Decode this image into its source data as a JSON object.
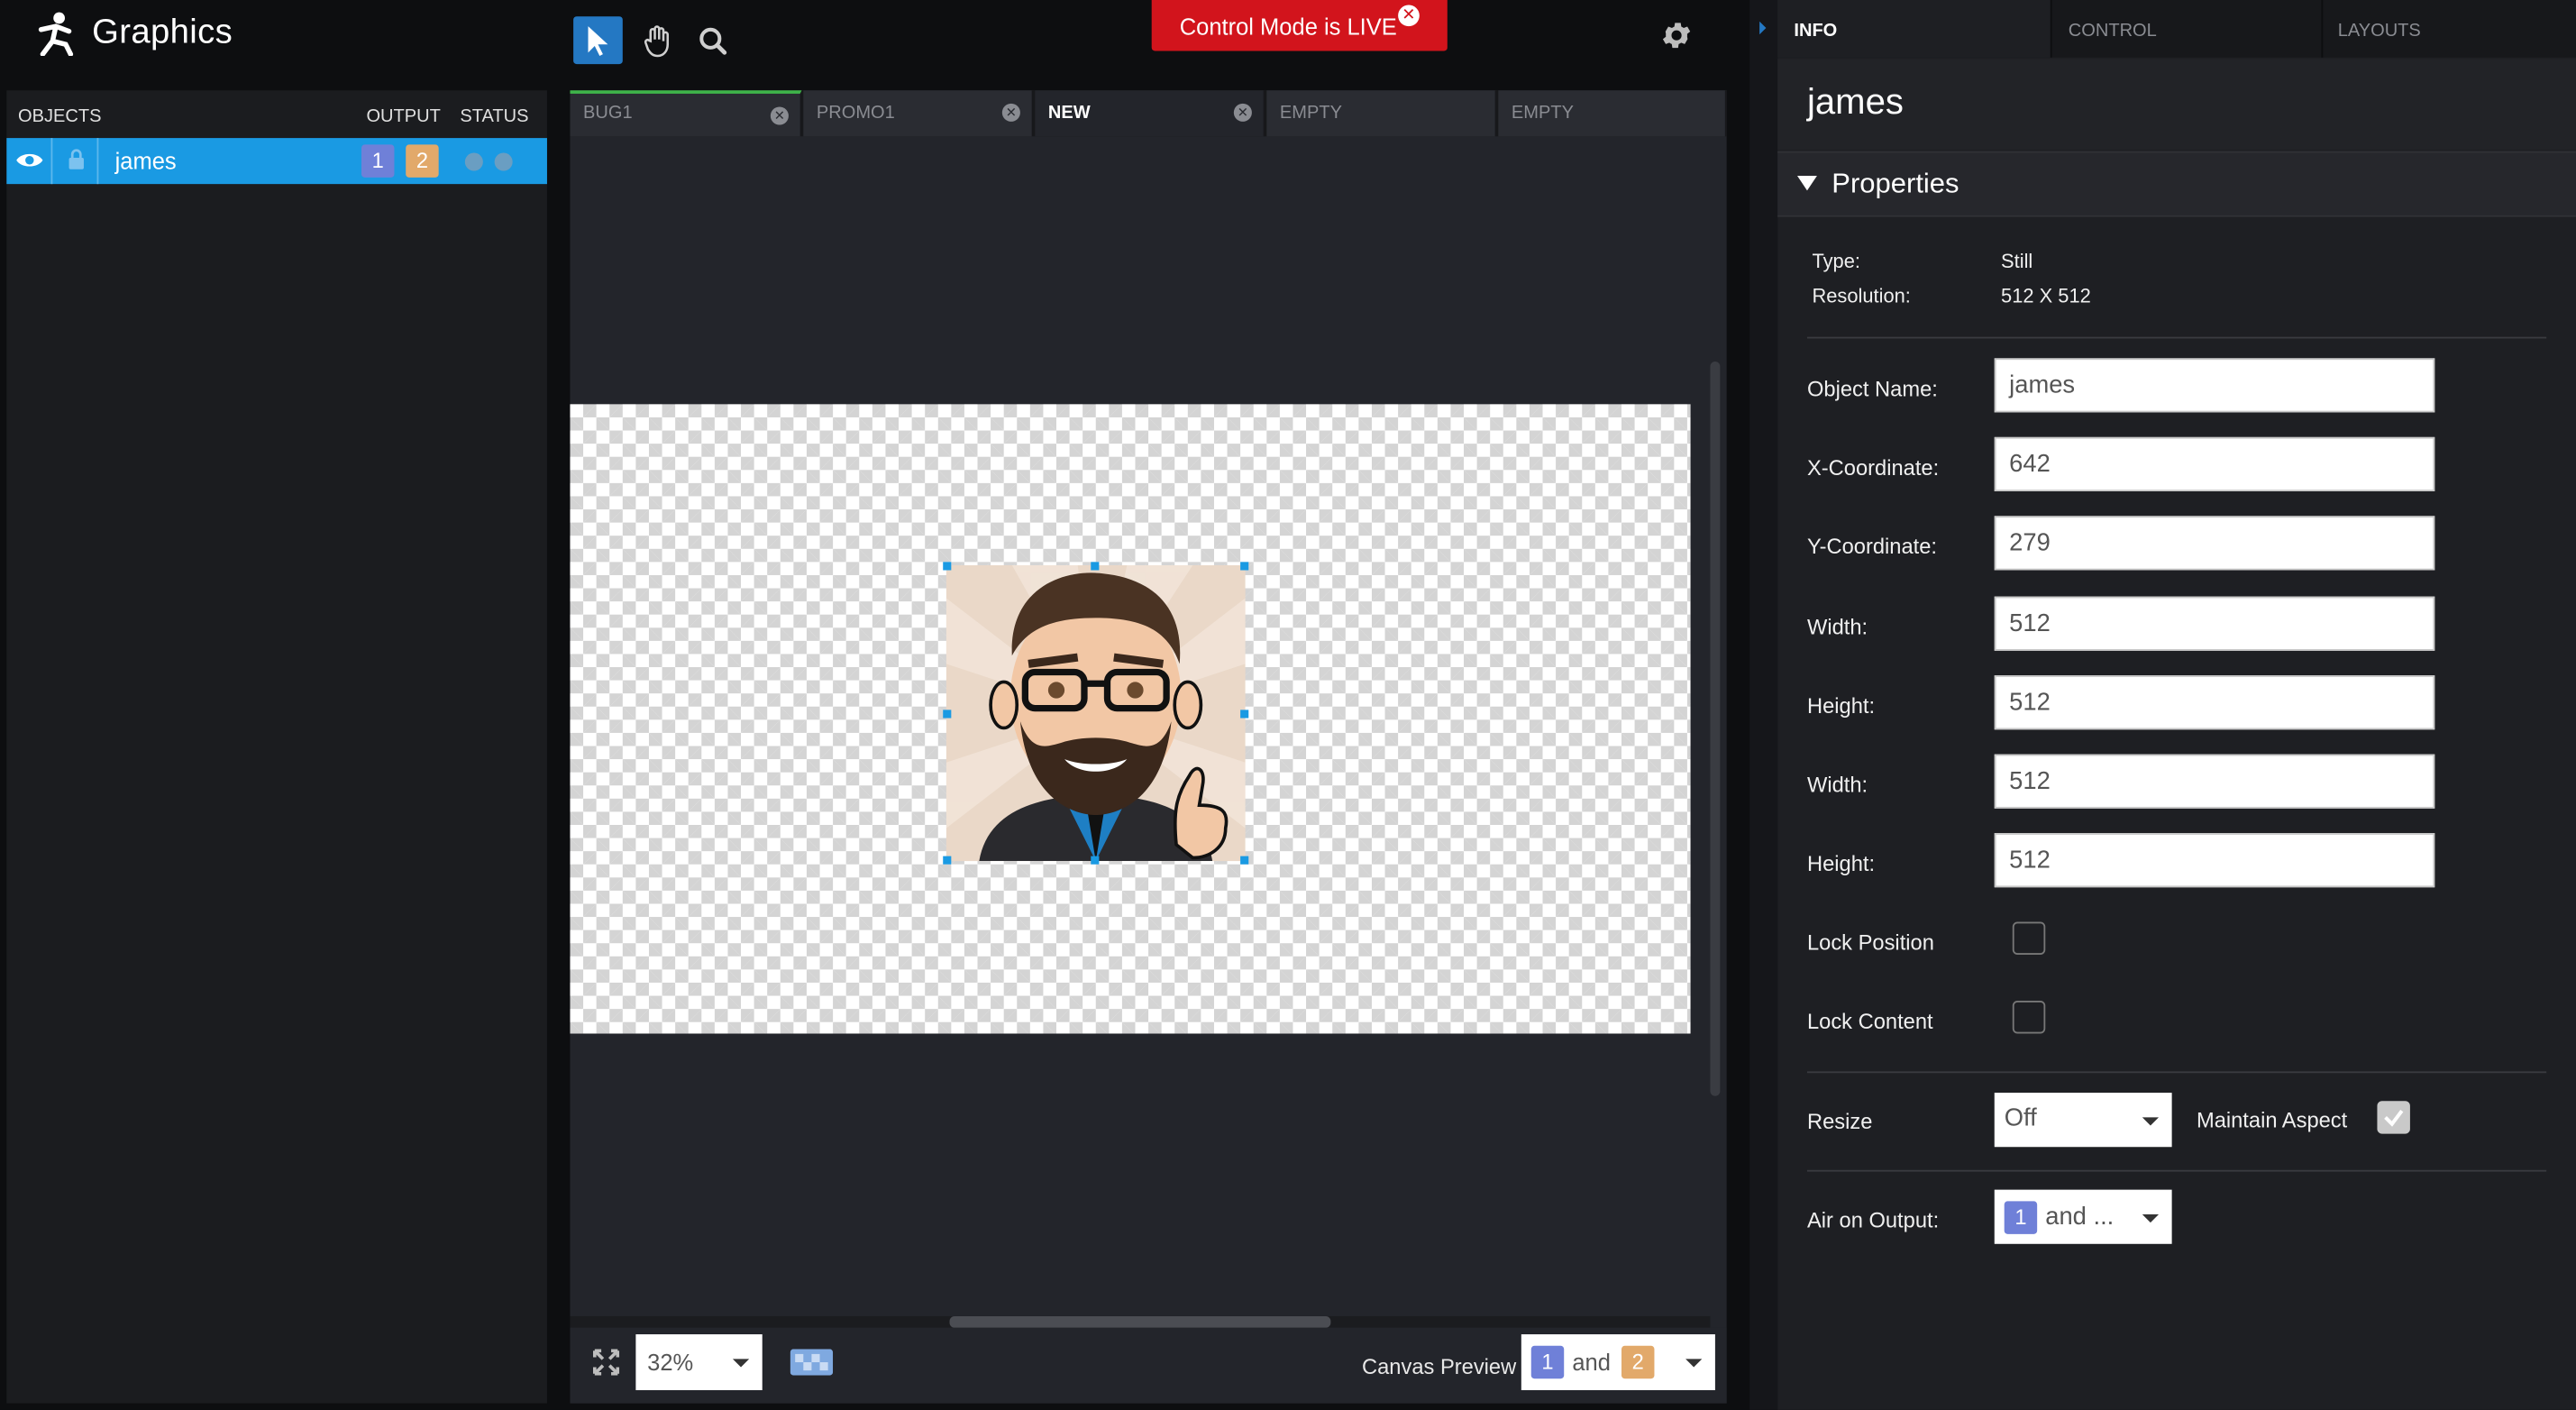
{
  "app": {
    "title": "Graphics"
  },
  "banner": {
    "text": "Control Mode is LIVE"
  },
  "objects_panel": {
    "headers": {
      "objects": "OBJECTS",
      "output": "OUTPUT",
      "status": "STATUS"
    },
    "rows": [
      {
        "name": "james",
        "outputs": [
          "1",
          "2"
        ]
      }
    ]
  },
  "canvas": {
    "tabs": [
      {
        "label": "BUG1"
      },
      {
        "label": "PROMO1"
      },
      {
        "label": "NEW"
      },
      {
        "label": "EMPTY"
      },
      {
        "label": "EMPTY"
      }
    ],
    "zoom": "32%",
    "canvas_preview": {
      "label": "Canvas Preview",
      "out1": "1",
      "and": "and",
      "out2": "2"
    }
  },
  "right_panel": {
    "tabs": [
      "INFO",
      "CONTROL",
      "LAYOUTS"
    ],
    "object_title": "james",
    "properties_label": "Properties",
    "type_label": "Type:",
    "type_value": "Still",
    "resolution_label": "Resolution:",
    "resolution_value": "512 X 512",
    "fields": {
      "object_name": {
        "label": "Object Name:",
        "value": "james"
      },
      "x": {
        "label": "X-Coordinate:",
        "value": "642"
      },
      "y": {
        "label": "Y-Coordinate:",
        "value": "279"
      },
      "width1": {
        "label": "Width:",
        "value": "512"
      },
      "height1": {
        "label": "Height:",
        "value": "512"
      },
      "width2": {
        "label": "Width:",
        "value": "512"
      },
      "height2": {
        "label": "Height:",
        "value": "512"
      }
    },
    "lock_position": {
      "label": "Lock Position",
      "checked": false
    },
    "lock_content": {
      "label": "Lock Content",
      "checked": false
    },
    "resize": {
      "label": "Resize",
      "value": "Off"
    },
    "maintain_aspect": {
      "label": "Maintain Aspect",
      "checked": true
    },
    "air_on_output": {
      "label": "Air on Output:",
      "badge": "1",
      "text": "and ..."
    }
  },
  "colors": {
    "accent": "#1a9ae3",
    "live": "#d2141c",
    "output1": "#6f80d8",
    "output2": "#e2a96a"
  }
}
